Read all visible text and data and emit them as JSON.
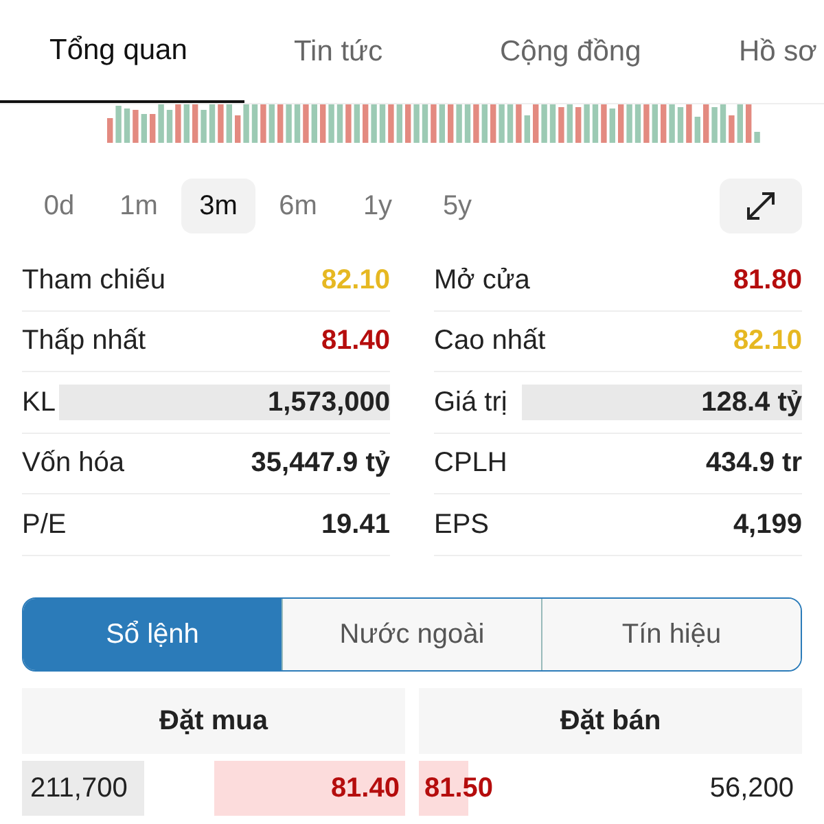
{
  "tabs": [
    {
      "label": "Tổng quan",
      "selected": true
    },
    {
      "label": "Tin tức",
      "selected": false
    },
    {
      "label": "Cộng đồng",
      "selected": false
    },
    {
      "label": "Hồ sơ",
      "selected": false
    }
  ],
  "periods": [
    {
      "label": "0d",
      "selected": false
    },
    {
      "label": "1m",
      "selected": false
    },
    {
      "label": "3m",
      "selected": true
    },
    {
      "label": "6m",
      "selected": false
    },
    {
      "label": "1y",
      "selected": false
    },
    {
      "label": "5y",
      "selected": false
    }
  ],
  "stats": [
    {
      "label": "Tham chiếu",
      "value": "82.10",
      "color": "#e6b822"
    },
    {
      "label": "Mở cửa",
      "value": "81.80",
      "color": "#b50d0d"
    },
    {
      "label": "Thấp nhất",
      "value": "81.40",
      "color": "#b50d0d"
    },
    {
      "label": "Cao nhất",
      "value": "82.10",
      "color": "#e6b822"
    },
    {
      "label": "KL",
      "value": "1,573,000",
      "color": "#222222",
      "level": 0.9
    },
    {
      "label": "Giá trị",
      "value": "128.4 tỷ",
      "color": "#222222",
      "level": 0.76
    },
    {
      "label": "Vốn hóa",
      "value": "35,447.9 tỷ",
      "color": "#222222"
    },
    {
      "label": "CPLH",
      "value": "434.9 tr",
      "color": "#222222"
    },
    {
      "label": "P/E",
      "value": "19.41",
      "color": "#222222"
    },
    {
      "label": "EPS",
      "value": "4,199",
      "color": "#222222"
    }
  ],
  "segments": [
    {
      "label": "Sổ lệnh",
      "selected": true
    },
    {
      "label": "Nước ngoài",
      "selected": false
    },
    {
      "label": "Tín hiệu",
      "selected": false
    }
  ],
  "order_book": {
    "headers": [
      "Đặt mua",
      "Đặt bán"
    ],
    "rows": [
      {
        "bid_volume": {
          "text": "211,700",
          "level": 0.32
        },
        "bid_price": {
          "text": "81.40",
          "level": 0.5
        },
        "ask_price": {
          "text": "81.50",
          "level": 0.13
        },
        "ask_volume": "56,200"
      }
    ]
  }
}
